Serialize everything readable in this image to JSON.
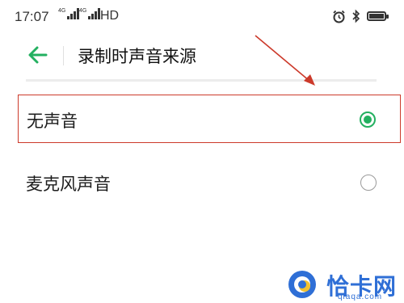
{
  "status_bar": {
    "time": "17:07",
    "network_1_label": "4G",
    "network_2_label": "4G",
    "hd_label": "HD",
    "icons": [
      "signal-icon",
      "alarm-icon",
      "bluetooth-icon",
      "battery-icon"
    ]
  },
  "header": {
    "back_icon": "arrow-left-icon",
    "title": "录制时声音来源"
  },
  "options": [
    {
      "label": "无声音",
      "selected": true
    },
    {
      "label": "麦克风声音",
      "selected": false
    }
  ],
  "annotation": {
    "color": "#cc3a2b"
  },
  "watermark": {
    "text": "恰卡网",
    "url": "qiaqa.com"
  },
  "colors": {
    "accent": "#23b060",
    "highlight": "#cc3a2b",
    "watermark": "#2f6fd6"
  }
}
